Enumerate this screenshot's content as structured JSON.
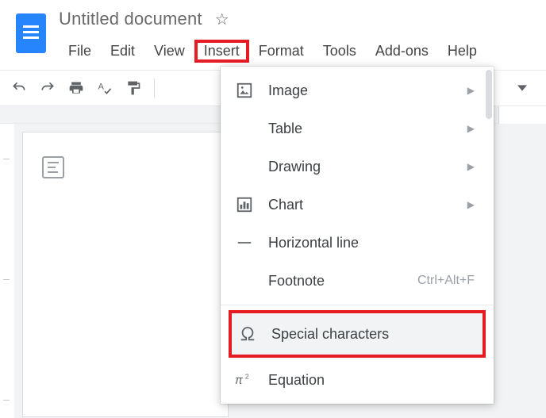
{
  "header": {
    "doc_title": "Untitled document"
  },
  "menubar": {
    "file": "File",
    "edit": "Edit",
    "view": "View",
    "insert": "Insert",
    "format": "Format",
    "tools": "Tools",
    "addons": "Add-ons",
    "help": "Help"
  },
  "insert_menu": {
    "image": "Image",
    "table": "Table",
    "drawing": "Drawing",
    "chart": "Chart",
    "horizontal_line": "Horizontal line",
    "footnote": "Footnote",
    "footnote_shortcut": "Ctrl+Alt+F",
    "special_characters": "Special characters",
    "equation": "Equation"
  }
}
